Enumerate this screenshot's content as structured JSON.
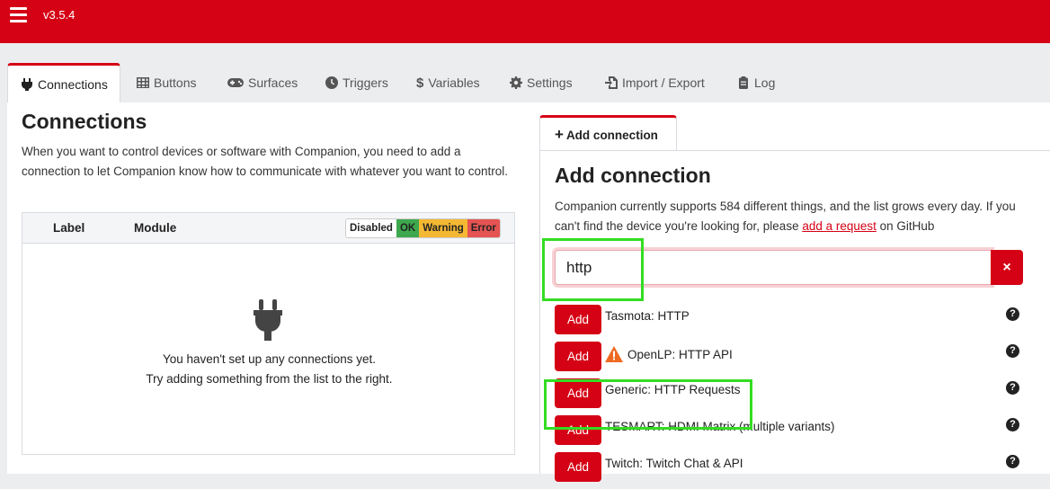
{
  "app": {
    "version": "v3.5.4"
  },
  "tabs": [
    {
      "label": "Connections",
      "icon": "plug-icon",
      "active": true
    },
    {
      "label": "Buttons",
      "icon": "grid-icon"
    },
    {
      "label": "Surfaces",
      "icon": "gamepad-icon"
    },
    {
      "label": "Triggers",
      "icon": "clock-icon"
    },
    {
      "label": "Variables",
      "icon": "dollar-icon"
    },
    {
      "label": "Settings",
      "icon": "gear-icon"
    },
    {
      "label": "Import / Export",
      "icon": "file-import-icon"
    },
    {
      "label": "Log",
      "icon": "clipboard-icon"
    }
  ],
  "connections": {
    "title": "Connections",
    "description": "When you want to control devices or software with Companion, you need to add a connection to let Companion know how to communicate with whatever you want to control.",
    "table": {
      "col_label": "Label",
      "col_module": "Module",
      "legend": {
        "disabled": "Disabled",
        "ok": "OK",
        "warning": "Warning",
        "error": "Error"
      },
      "empty_line1": "You haven't set up any connections yet.",
      "empty_line2": "Try adding something from the list to the right."
    }
  },
  "add_connection": {
    "tab_label": "Add connection",
    "title": "Add connection",
    "desc_before": "Companion currently supports 584 different things, and the list grows every day. If you can't find the device you're looking for, please ",
    "desc_link": "add a request",
    "desc_after": " on GitHub",
    "search_value": "http",
    "clear_label": "×",
    "add_label": "Add",
    "modules": [
      {
        "name": "Tasmota: HTTP",
        "warning": false
      },
      {
        "name": "OpenLP: HTTP API",
        "warning": true
      },
      {
        "name": "Generic: HTTP Requests",
        "warning": false
      },
      {
        "name": "TESMART: HDMI Matrix (multiple variants)",
        "warning": false
      },
      {
        "name": "Twitch: Twitch Chat & API",
        "warning": false
      }
    ]
  },
  "colors": {
    "brand": "#d50215",
    "highlight": "#33dd22"
  }
}
